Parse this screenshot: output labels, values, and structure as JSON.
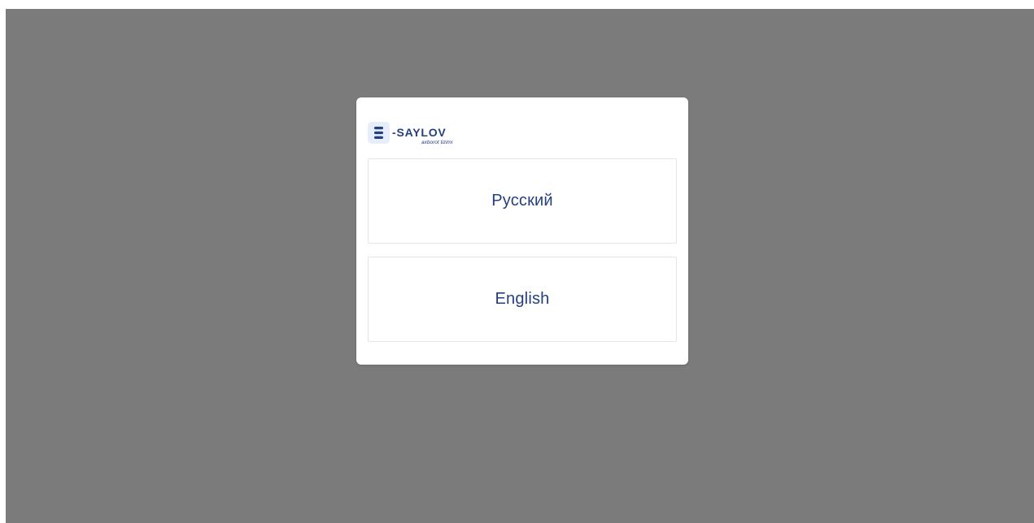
{
  "brand": {
    "logo_text": "-SAYLOV",
    "logo_subtitle": "axborot tizimi",
    "logo_icon": "e-letter-icon",
    "brand_color": "#25407f",
    "icon_bg_color": "#e6eefc"
  },
  "languages": [
    {
      "label": "Русский"
    },
    {
      "label": "English"
    }
  ],
  "colors": {
    "overlay": "#7b7b7c",
    "modal_bg": "#ffffff",
    "button_border": "#e3e5e8",
    "button_text": "#25407f"
  }
}
